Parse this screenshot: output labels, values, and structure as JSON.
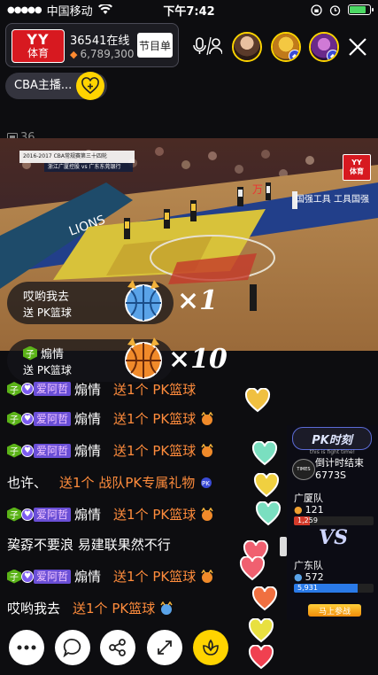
{
  "status_bar": {
    "carrier": "中国移动",
    "time": "下午7:42"
  },
  "host": {
    "logo_top": "YY",
    "logo_bottom": "体育",
    "online": "36541在线",
    "coins": "6,789,300",
    "program_button": "节目单"
  },
  "anchor_tag": "CBA主播...",
  "room_number": "36",
  "video": {
    "scorebug": "2016-2017 CBA常规赛第三十四轮",
    "scorebug_sub": "浙江广厦控股 vs 广东东莞银行",
    "logo_top": "YY",
    "logo_bottom": "体育",
    "ad_text": "国强工具 工具国强"
  },
  "gift_banners": [
    {
      "user": "哎哟我去",
      "gift": "送 PK篮球",
      "multiplier": "×1",
      "level": ""
    },
    {
      "user": "煽情",
      "gift": "送 PK篮球",
      "multiplier": "×10",
      "level": "子"
    }
  ],
  "chat": [
    {
      "level": "子",
      "fan": "爱阿哲",
      "name": "煽情",
      "message": "送1个 PK篮球"
    },
    {
      "level": "子",
      "fan": "爱阿哲",
      "name": "煽情",
      "message": "送1个 PK篮球"
    },
    {
      "level": "",
      "fan": "",
      "name": "也许、",
      "message": "送1个 战队PK专属礼物"
    },
    {
      "level": "子",
      "fan": "爱阿哲",
      "name": "煽情",
      "message": "送1个 PK篮球"
    },
    {
      "level": "",
      "fan": "",
      "name": "",
      "message": "",
      "plain": "巭孬不要浪 易建联果然不行"
    },
    {
      "level": "子",
      "fan": "爱阿哲",
      "name": "煽情",
      "message": "送1个 PK篮球"
    },
    {
      "level": "",
      "fan": "",
      "name": "哎哟我去",
      "message": "送1个 PK篮球"
    }
  ],
  "pk_panel": {
    "title": "PK时刻",
    "subtitle": "this is fight time!",
    "countdown_label": "倒计时结束",
    "countdown": "6773S",
    "times_label": "TIMES",
    "team1": {
      "name": "广厦队",
      "fans": "121",
      "points": "1,259"
    },
    "team2": {
      "name": "广东队",
      "fans": "572",
      "points": "5,931"
    },
    "vs": "VS",
    "ready_button": "马上参战"
  },
  "colors": {
    "accent_yellow": "#ffd400",
    "gift_orange": "#ff8c3c",
    "brand_red": "#d71920"
  }
}
